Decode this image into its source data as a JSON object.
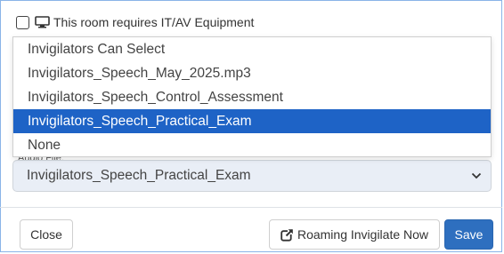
{
  "equipment": {
    "label": "This room requires IT/AV Equipment",
    "checked": false,
    "icon": "monitor-icon"
  },
  "audio": {
    "label": "Audio File:",
    "value": "Invigilators_Speech_Practical_Exam",
    "options": [
      "Invigilators Can Select",
      "Invigilators_Speech_May_2025.mp3",
      "Invigilators_Speech_Control_Assessment",
      "Invigilators_Speech_Practical_Exam",
      "None"
    ],
    "selected_index": 3
  },
  "footer": {
    "close_label": "Close",
    "roaming_label": "Roaming Invigilate Now",
    "roaming_icon": "external-link-icon",
    "save_label": "Save"
  },
  "colors": {
    "selected_option": "#1e63c6",
    "save_button": "#2e6fbf",
    "frame_border": "#8ab4e8"
  }
}
